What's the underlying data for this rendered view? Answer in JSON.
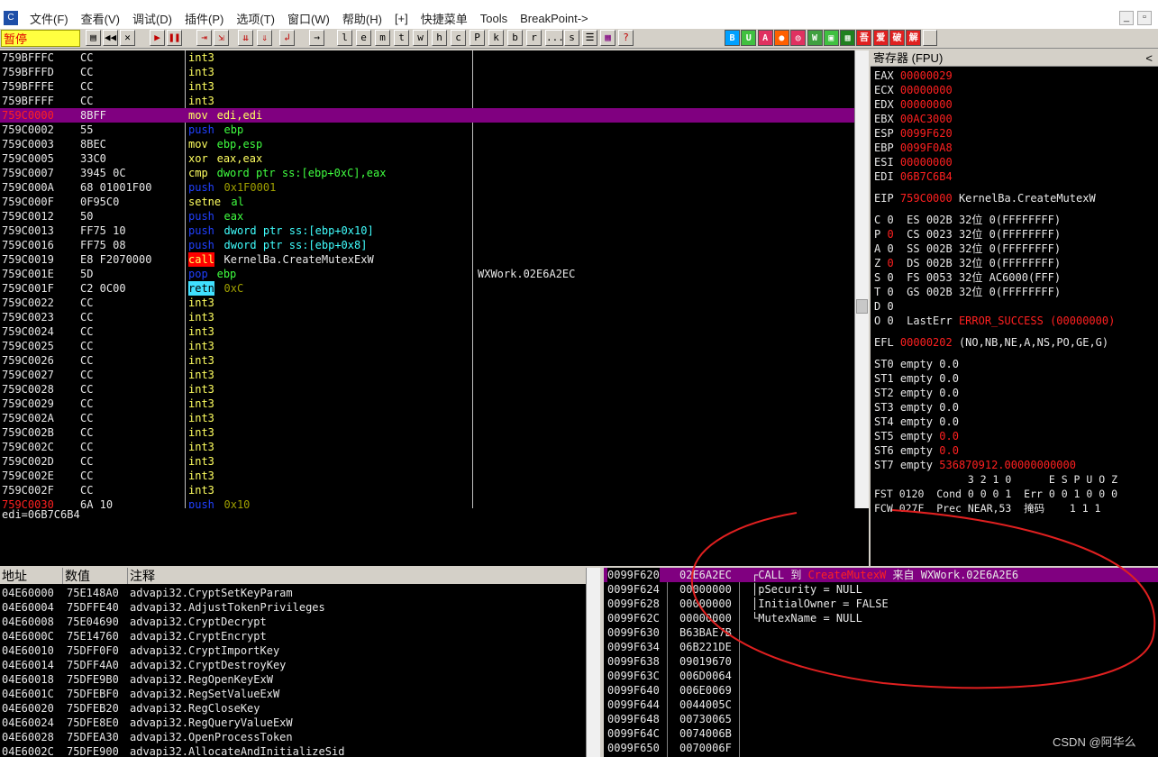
{
  "menu": [
    "文件(F)",
    "查看(V)",
    "调试(D)",
    "插件(P)",
    "选项(T)",
    "窗口(W)",
    "帮助(H)",
    "[+]",
    "快捷菜单",
    "Tools",
    "BreakPoint->"
  ],
  "status": "暂停",
  "toolbar_letters": [
    "l",
    "e",
    "m",
    "t",
    "w",
    "h",
    "c",
    "P",
    "k",
    "b",
    "r",
    "...",
    "s"
  ],
  "toolbar_colored": [
    {
      "t": "B",
      "c": "#00a0ff"
    },
    {
      "t": "U",
      "c": "#40c040"
    },
    {
      "t": "A",
      "c": "#e03060"
    },
    {
      "t": "●",
      "c": "#ff6000"
    },
    {
      "t": "◎",
      "c": "#e03060"
    },
    {
      "t": "W",
      "c": "#40a040"
    },
    {
      "t": "▣",
      "c": "#40c040"
    },
    {
      "t": "▦",
      "c": "#208020"
    },
    {
      "t": "吾",
      "c": "#e02020"
    },
    {
      "t": "爱",
      "c": "#e02020"
    },
    {
      "t": "破",
      "c": "#e02020"
    },
    {
      "t": "解",
      "c": "#e02020"
    }
  ],
  "disasm": [
    {
      "addr": "759BFFFC",
      "hex": "CC",
      "mn": "int3",
      "mc": "y",
      "ops": "",
      "oc": ""
    },
    {
      "addr": "759BFFFD",
      "hex": "CC",
      "mn": "int3",
      "mc": "y",
      "ops": "",
      "oc": ""
    },
    {
      "addr": "759BFFFE",
      "hex": "CC",
      "mn": "int3",
      "mc": "y",
      "ops": "",
      "oc": ""
    },
    {
      "addr": "759BFFFF",
      "hex": "CC",
      "mn": "int3",
      "mc": "y",
      "ops": "",
      "oc": ""
    },
    {
      "addr": "759C0000",
      "hex": "8BFF",
      "mn": "mov",
      "mc": "y",
      "ops": "edi,edi",
      "oc": "y",
      "hl": true
    },
    {
      "addr": "759C0002",
      "hex": "55",
      "mn": "push",
      "mc": "b",
      "ops": "ebp",
      "oc": "g"
    },
    {
      "addr": "759C0003",
      "hex": "8BEC",
      "mn": "mov",
      "mc": "y",
      "ops": "ebp,esp",
      "oc": "g"
    },
    {
      "addr": "759C0005",
      "hex": "33C0",
      "mn": "xor",
      "mc": "y",
      "ops": "eax,eax",
      "oc": "y"
    },
    {
      "addr": "759C0007",
      "hex": "3945 0C",
      "mn": "cmp",
      "mc": "y",
      "ops": "dword ptr ss:[ebp+0xC],eax",
      "oc": "g"
    },
    {
      "addr": "759C000A",
      "hex": "68 01001F00",
      "mn": "push",
      "mc": "b",
      "ops": "0x1F0001",
      "oc": "n"
    },
    {
      "addr": "759C000F",
      "hex": "0F95C0",
      "mn": "setne",
      "mc": "y",
      "ops": "al",
      "oc": "g"
    },
    {
      "addr": "759C0012",
      "hex": "50",
      "mn": "push",
      "mc": "b",
      "ops": "eax",
      "oc": "g"
    },
    {
      "addr": "759C0013",
      "hex": "FF75 10",
      "mn": "push",
      "mc": "b",
      "ops": "dword ptr ss:[ebp+0x10]",
      "oc": "c"
    },
    {
      "addr": "759C0016",
      "hex": "FF75 08",
      "mn": "push",
      "mc": "b",
      "ops": "dword ptr ss:[ebp+0x8]",
      "oc": "c"
    },
    {
      "addr": "759C0019",
      "hex": "E8 F2070000",
      "mn": "call",
      "mc": "call",
      "ops": "KernelBa.CreateMutexExW",
      "oc": "w"
    },
    {
      "addr": "759C001E",
      "hex": "5D",
      "mn": "pop",
      "mc": "b",
      "ops": "ebp",
      "oc": "g",
      "cmt": "WXWork.02E6A2EC"
    },
    {
      "addr": "759C001F",
      "hex": "C2 0C00",
      "mn": "retn",
      "mc": "retn",
      "ops": "0xC",
      "oc": "n"
    },
    {
      "addr": "759C0022",
      "hex": "CC",
      "mn": "int3",
      "mc": "y",
      "ops": "",
      "oc": ""
    },
    {
      "addr": "759C0023",
      "hex": "CC",
      "mn": "int3",
      "mc": "y",
      "ops": "",
      "oc": ""
    },
    {
      "addr": "759C0024",
      "hex": "CC",
      "mn": "int3",
      "mc": "y",
      "ops": "",
      "oc": ""
    },
    {
      "addr": "759C0025",
      "hex": "CC",
      "mn": "int3",
      "mc": "y",
      "ops": "",
      "oc": ""
    },
    {
      "addr": "759C0026",
      "hex": "CC",
      "mn": "int3",
      "mc": "y",
      "ops": "",
      "oc": ""
    },
    {
      "addr": "759C0027",
      "hex": "CC",
      "mn": "int3",
      "mc": "y",
      "ops": "",
      "oc": ""
    },
    {
      "addr": "759C0028",
      "hex": "CC",
      "mn": "int3",
      "mc": "y",
      "ops": "",
      "oc": ""
    },
    {
      "addr": "759C0029",
      "hex": "CC",
      "mn": "int3",
      "mc": "y",
      "ops": "",
      "oc": ""
    },
    {
      "addr": "759C002A",
      "hex": "CC",
      "mn": "int3",
      "mc": "y",
      "ops": "",
      "oc": ""
    },
    {
      "addr": "759C002B",
      "hex": "CC",
      "mn": "int3",
      "mc": "y",
      "ops": "",
      "oc": ""
    },
    {
      "addr": "759C002C",
      "hex": "CC",
      "mn": "int3",
      "mc": "y",
      "ops": "",
      "oc": ""
    },
    {
      "addr": "759C002D",
      "hex": "CC",
      "mn": "int3",
      "mc": "y",
      "ops": "",
      "oc": ""
    },
    {
      "addr": "759C002E",
      "hex": "CC",
      "mn": "int3",
      "mc": "y",
      "ops": "",
      "oc": ""
    },
    {
      "addr": "759C002F",
      "hex": "CC",
      "mn": "int3",
      "mc": "y",
      "ops": "",
      "oc": ""
    },
    {
      "addr": "759C0030",
      "hex": "6A 10",
      "mn": "push",
      "mc": "b",
      "ops": "0x10",
      "oc": "n",
      "addr_red": true
    }
  ],
  "info_line": "edi=06B7C6B4",
  "registers": {
    "title": "寄存器 (FPU)",
    "chevron": "<",
    "gp": [
      {
        "n": "EAX",
        "v": "00000029"
      },
      {
        "n": "ECX",
        "v": "00000000"
      },
      {
        "n": "EDX",
        "v": "00000000"
      },
      {
        "n": "EBX",
        "v": "00AC3000"
      },
      {
        "n": "ESP",
        "v": "0099F620"
      },
      {
        "n": "EBP",
        "v": "0099F0A8"
      },
      {
        "n": "ESI",
        "v": "00000000"
      },
      {
        "n": "EDI",
        "v": "06B7C6B4"
      }
    ],
    "eip": {
      "n": "EIP",
      "v": "759C0000",
      "t": "KernelBa.CreateMutexW"
    },
    "flags": [
      {
        "f": "C",
        "v": "0",
        "red": false,
        "seg": "ES 002B 32位 0(FFFFFFFF)"
      },
      {
        "f": "P",
        "v": "0",
        "red": true,
        "seg": "CS 0023 32位 0(FFFFFFFF)"
      },
      {
        "f": "A",
        "v": "0",
        "red": false,
        "seg": "SS 002B 32位 0(FFFFFFFF)"
      },
      {
        "f": "Z",
        "v": "0",
        "red": true,
        "seg": "DS 002B 32位 0(FFFFFFFF)"
      },
      {
        "f": "S",
        "v": "0",
        "red": false,
        "seg": "FS 0053 32位 AC6000(FFF)"
      },
      {
        "f": "T",
        "v": "0",
        "red": false,
        "seg": "GS 002B 32位 0(FFFFFFFF)"
      },
      {
        "f": "D",
        "v": "0",
        "red": false,
        "seg": ""
      }
    ],
    "lasterr_label": "O 0  LastErr",
    "lasterr_val": "ERROR_SUCCESS (00000000)",
    "efl_label": "EFL",
    "efl_val": "00000202",
    "efl_rest": "(NO,NB,NE,A,NS,PO,GE,G)",
    "st": [
      {
        "n": "ST0 empty",
        "v": "0.0",
        "red": false
      },
      {
        "n": "ST1 empty",
        "v": "0.0",
        "red": false
      },
      {
        "n": "ST2 empty",
        "v": "0.0",
        "red": false
      },
      {
        "n": "ST3 empty",
        "v": "0.0",
        "red": false
      },
      {
        "n": "ST4 empty",
        "v": "0.0",
        "red": false
      },
      {
        "n": "ST5 empty",
        "v": "0.0",
        "red": true
      },
      {
        "n": "ST6 empty",
        "v": "0.0",
        "red": true
      },
      {
        "n": "ST7 empty",
        "v": "536870912.00000000000",
        "red": true
      }
    ],
    "fpu_hdr": "               3 2 1 0      E S P U O Z",
    "fst": "FST 0120  Cond 0 0 0 1  Err 0 0 1 0 0 0",
    "fcw": "FCW 027F  Prec NEAR,53  掩码    1 1 1"
  },
  "dump": {
    "headers": [
      "地址",
      "数值",
      "注释"
    ],
    "rows": [
      {
        "a": "04E60000",
        "v": "75E148A0",
        "c": "advapi32.CryptSetKeyParam"
      },
      {
        "a": "04E60004",
        "v": "75DFFE40",
        "c": "advapi32.AdjustTokenPrivileges"
      },
      {
        "a": "04E60008",
        "v": "75E04690",
        "c": "advapi32.CryptDecrypt"
      },
      {
        "a": "04E6000C",
        "v": "75E14760",
        "c": "advapi32.CryptEncrypt"
      },
      {
        "a": "04E60010",
        "v": "75DFF0F0",
        "c": "advapi32.CryptImportKey"
      },
      {
        "a": "04E60014",
        "v": "75DFF4A0",
        "c": "advapi32.CryptDestroyKey"
      },
      {
        "a": "04E60018",
        "v": "75DFE9B0",
        "c": "advapi32.RegOpenKeyExW"
      },
      {
        "a": "04E6001C",
        "v": "75DFEBF0",
        "c": "advapi32.RegSetValueExW"
      },
      {
        "a": "04E60020",
        "v": "75DFEB20",
        "c": "advapi32.RegCloseKey"
      },
      {
        "a": "04E60024",
        "v": "75DFE8E0",
        "c": "advapi32.RegQueryValueExW"
      },
      {
        "a": "04E60028",
        "v": "75DFEA30",
        "c": "advapi32.OpenProcessToken"
      },
      {
        "a": "04E6002C",
        "v": "75DFE900",
        "c": "advapi32.AllocateAndInitializeSid"
      }
    ]
  },
  "stack": [
    {
      "a": "0099F620",
      "v": "02E6A2EC",
      "hl": true,
      "c1": "┌CALL 到 ",
      "c2": "CreateMutexW",
      "c3": " 来自 WXWork.02E6A2E6"
    },
    {
      "a": "0099F624",
      "v": "00000000",
      "c1": "│pSecurity = NULL"
    },
    {
      "a": "0099F628",
      "v": "00000000",
      "c1": "│InitialOwner = FALSE"
    },
    {
      "a": "0099F62C",
      "v": "00000000",
      "c1": "└MutexName = NULL"
    },
    {
      "a": "0099F630",
      "v": "B63BAE7B"
    },
    {
      "a": "0099F634",
      "v": "06B221DE"
    },
    {
      "a": "0099F638",
      "v": "09019670"
    },
    {
      "a": "0099F63C",
      "v": "006D0064"
    },
    {
      "a": "0099F640",
      "v": "006E0069"
    },
    {
      "a": "0099F644",
      "v": "0044005C"
    },
    {
      "a": "0099F648",
      "v": "00730065"
    },
    {
      "a": "0099F64C",
      "v": "0074006B"
    },
    {
      "a": "0099F650",
      "v": "0070006F"
    }
  ],
  "watermark": "CSDN @阿华么",
  "colors": {
    "highlight": "#800080",
    "annotation": "#e02020"
  }
}
